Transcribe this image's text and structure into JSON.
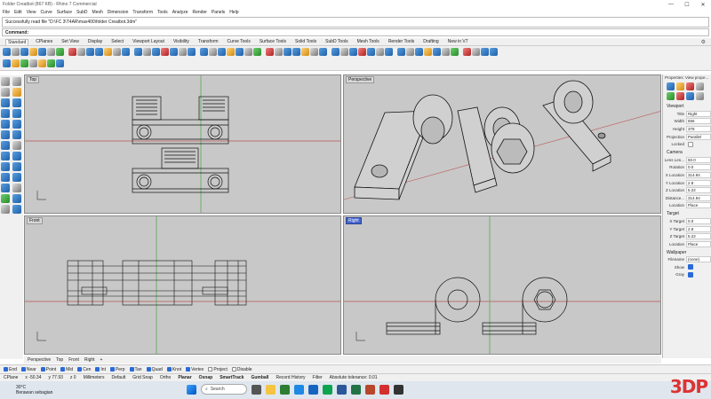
{
  "window": {
    "title": "Folder Creatbot (867 KB) - Rhino 7 Commercial",
    "controls": [
      "—",
      "☐",
      "✕"
    ]
  },
  "menu": [
    "File",
    "Edit",
    "View",
    "Curve",
    "Surface",
    "SubD",
    "Mesh",
    "Dimension",
    "Transform",
    "Tools",
    "Analyze",
    "Render",
    "Panels",
    "Help"
  ],
  "command_history": "Successfully read file \"D:\\FC 3\\T4AR\\max400\\folder Creatbot.3dm\"",
  "command_prompt": "Command:",
  "tabs": [
    "Standard",
    "CPlanes",
    "Set View",
    "Display",
    "Select",
    "Viewport Layout",
    "Visibility",
    "Transform",
    "Curve Tools",
    "Surface Tools",
    "Solid Tools",
    "SubD Tools",
    "Mesh Tools",
    "Render Tools",
    "Drafting",
    "New in V7"
  ],
  "viewports": {
    "top": "Top",
    "perspective": "Perspective",
    "front": "Front",
    "right": "Right"
  },
  "viewport_tabs": [
    "Perspective",
    "Top",
    "Front",
    "Right",
    "+"
  ],
  "properties": {
    "header": "Properties: View prope...",
    "viewport_section": "Viewport",
    "viewport_rows": [
      {
        "k": "Title",
        "v": "Right"
      },
      {
        "k": "Width",
        "v": "656"
      },
      {
        "k": "Height",
        "v": "378"
      },
      {
        "k": "Projection",
        "v": "Parallel"
      }
    ],
    "locked_label": "Locked",
    "camera_section": "Camera",
    "camera_rows": [
      {
        "k": "Lens Len...",
        "v": "50.0"
      },
      {
        "k": "Rotation",
        "v": "0.0"
      },
      {
        "k": "X Location",
        "v": "314.94"
      },
      {
        "k": "Y Location",
        "v": "2.8"
      },
      {
        "k": "Z Location",
        "v": "5.22"
      },
      {
        "k": "Distance...",
        "v": "314.94"
      },
      {
        "k": "Location",
        "v": "Place"
      }
    ],
    "target_section": "Target",
    "target_rows": [
      {
        "k": "X Target",
        "v": "0.0"
      },
      {
        "k": "Y Target",
        "v": "2.8"
      },
      {
        "k": "Z Target",
        "v": "5.22"
      },
      {
        "k": "Location",
        "v": "Place"
      }
    ],
    "wallpaper_section": "Wallpaper",
    "filename_label": "Filename",
    "filename_value": "(none)",
    "show_label": "Show",
    "gray_label": "Gray"
  },
  "osnaps": [
    {
      "label": "End",
      "on": true
    },
    {
      "label": "Near",
      "on": true
    },
    {
      "label": "Point",
      "on": true
    },
    {
      "label": "Mid",
      "on": true
    },
    {
      "label": "Cen",
      "on": true
    },
    {
      "label": "Int",
      "on": true
    },
    {
      "label": "Perp",
      "on": true
    },
    {
      "label": "Tan",
      "on": true
    },
    {
      "label": "Quad",
      "on": true
    },
    {
      "label": "Knot",
      "on": true
    },
    {
      "label": "Vertex",
      "on": true
    },
    {
      "label": "Project",
      "on": false
    },
    {
      "label": "Disable",
      "on": false
    }
  ],
  "status": {
    "cplane": "CPlane",
    "x": "x -50.34",
    "y": "y 77.93",
    "z": "z 0",
    "units": "Millimeters",
    "layer": "Default",
    "grid_snap": "Grid Snap",
    "ortho": "Ortho",
    "planar": "Planar",
    "osnap": "Osnap",
    "smarttrack": "SmartTrack",
    "gumball": "Gumball",
    "record_history": "Record History",
    "filter": "Filter",
    "tolerance": "Absolute tolerance: 0.01"
  },
  "taskbar": {
    "temp": "30°C",
    "weather": "Berawan sebagian",
    "search": "Search"
  },
  "watermark": "3DP"
}
